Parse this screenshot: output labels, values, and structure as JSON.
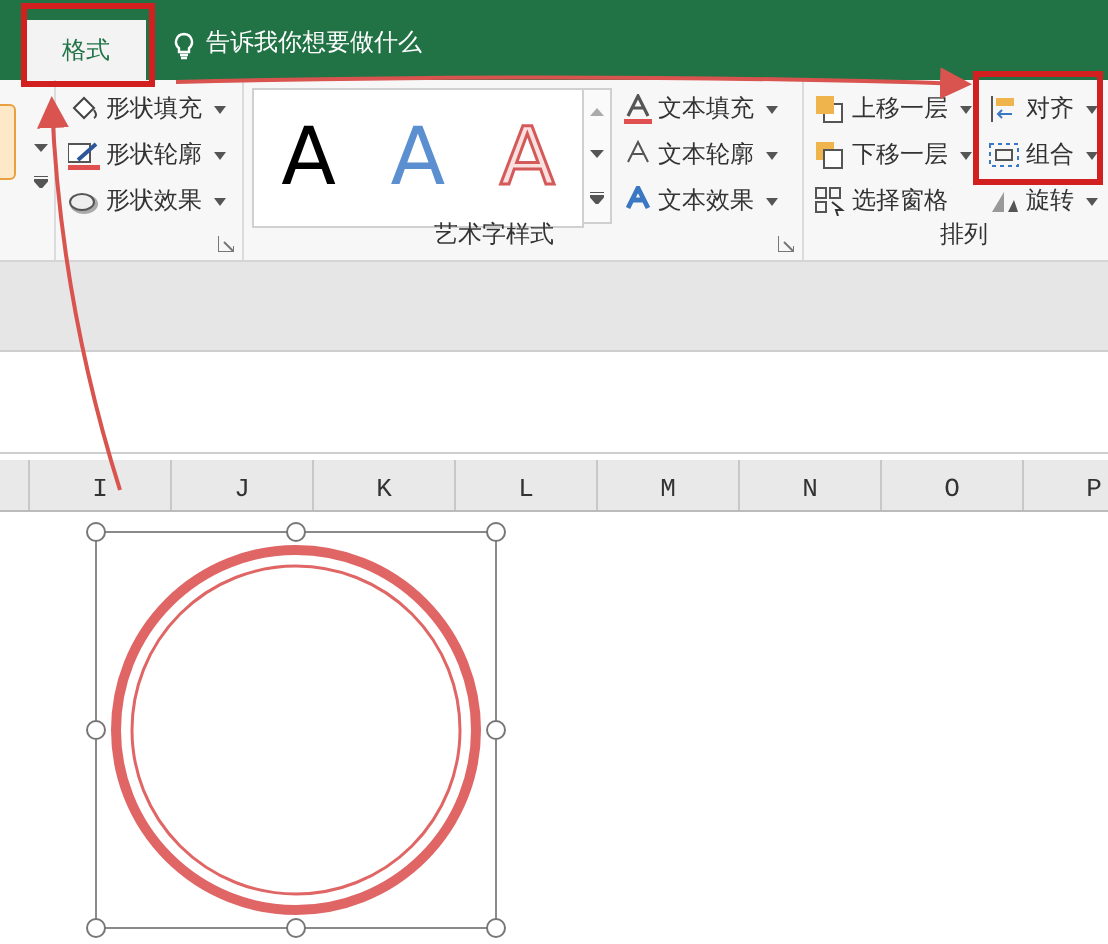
{
  "tabs": [
    {
      "label": "格式",
      "selected": true
    }
  ],
  "tell_me": {
    "text": "告诉我你想要做什么"
  },
  "shape_styles": {
    "items": [
      {
        "label": "形状填充",
        "kind": "fill",
        "dropdown": true
      },
      {
        "label": "形状轮廓",
        "kind": "outline",
        "dropdown": true
      },
      {
        "label": "形状效果",
        "kind": "effect",
        "dropdown": true
      }
    ]
  },
  "wordart_styles": {
    "title": "艺术字样式",
    "samples": [
      {
        "letter": "A",
        "kind": "plain"
      },
      {
        "letter": "A",
        "kind": "blue"
      },
      {
        "letter": "A",
        "kind": "outline"
      }
    ],
    "items": [
      {
        "label": "文本填充",
        "kind": "text-fill",
        "dropdown": true
      },
      {
        "label": "文本轮廓",
        "kind": "text-outline",
        "dropdown": true
      },
      {
        "label": "文本效果",
        "kind": "text-effect",
        "dropdown": true
      }
    ]
  },
  "arrange": {
    "title": "排列",
    "columns": [
      [
        {
          "label": "上移一层",
          "kind": "forward",
          "dropdown": true
        },
        {
          "label": "下移一层",
          "kind": "backward",
          "dropdown": true
        },
        {
          "label": "选择窗格",
          "kind": "pane",
          "dropdown": false
        }
      ],
      [
        {
          "label": "对齐",
          "kind": "align",
          "dropdown": true
        },
        {
          "label": "组合",
          "kind": "group",
          "dropdown": true
        },
        {
          "label": "旋转",
          "kind": "rotate",
          "dropdown": true
        }
      ]
    ]
  },
  "columns": [
    "I",
    "J",
    "K",
    "L",
    "M",
    "N",
    "O",
    "P"
  ]
}
